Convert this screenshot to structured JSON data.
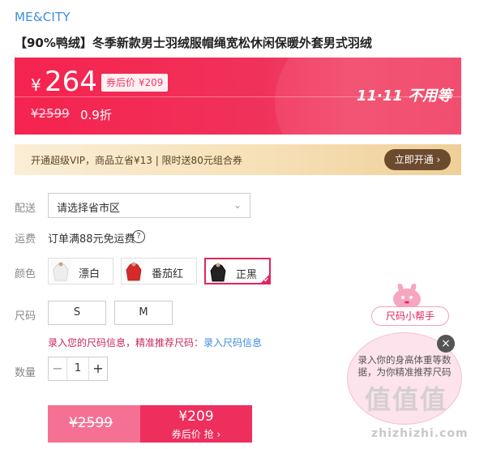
{
  "brand": "ME&CITY",
  "product_title": "【90%鸭绒】冬季新款男士羽绒服帽绳宽松休闲保暖外套男式羽绒",
  "price_banner": {
    "currency": "¥",
    "price": "264",
    "coupon_label": "券后价 ¥209",
    "original_price": "¥2599",
    "discount": "0.9折",
    "promo_text": "11·11 不用等"
  },
  "vip_bar": {
    "text": "开通超级VIP，商品立省¥13 | 限时送80元组合券",
    "button": "立即开通 ›"
  },
  "delivery": {
    "label": "配送",
    "placeholder": "请选择省市区"
  },
  "shipping": {
    "label": "运费",
    "text": "订单满88元免运费",
    "help_icon": "question-circle-icon"
  },
  "colors": {
    "label": "颜色",
    "options": [
      {
        "name": "漂白",
        "selected": false,
        "swatch_color": "#f2f2f2"
      },
      {
        "name": "番茄红",
        "selected": false,
        "swatch_color": "#d62a2a"
      },
      {
        "name": "正黑",
        "selected": true,
        "swatch_color": "#222222"
      }
    ]
  },
  "sizes": {
    "label": "尺码",
    "options": [
      "S",
      "M"
    ],
    "hint": "录入您的尺码信息，精准推荐尺码：",
    "hint_link": "录入尺码信息"
  },
  "quantity": {
    "label": "数量",
    "value": "1",
    "minus": "−",
    "plus": "+"
  },
  "buy": {
    "original_price": "¥2599",
    "coupon_price": "¥209",
    "cta": "券后价 抢 ›"
  },
  "size_helper": {
    "pill": "尺码小帮手",
    "bubble_text": "录入你的身高体重等数据，为你精准推荐尺码",
    "close": "×"
  },
  "watermark": {
    "logo": "值值值",
    "site": "zhizhizhi.com"
  },
  "accent_colors": {
    "primary": "#f23a62",
    "link": "#3c8de0",
    "vip_button": "#6b4a2e"
  }
}
